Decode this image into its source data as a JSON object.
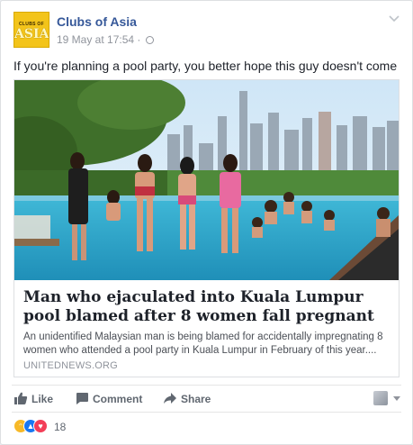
{
  "post": {
    "page_name": "Clubs of Asia",
    "avatar_small": "CLUBS OF",
    "avatar_big": "ASIA",
    "timestamp": "19 May at 17:54 ·",
    "message": "If you're planning a pool party, you better hope this guy doesn't come"
  },
  "link": {
    "title": "Man who ejaculated into Kuala Lumpur pool blamed after 8 women fall pregnant",
    "description": "An unidentified Malaysian man is being blamed for accidentally impregnating 8 women who attended a pool party in Kuala Lumpur in February of this year....",
    "domain": "UNITEDNEWS.ORG"
  },
  "actions": {
    "like_label": "Like",
    "comment_label": "Comment",
    "share_label": "Share"
  },
  "reactions": {
    "types": [
      "haha",
      "like",
      "love"
    ],
    "count": "18"
  },
  "colors": {
    "link_blue": "#365899",
    "muted": "#90949c",
    "action_gray": "#606770"
  }
}
